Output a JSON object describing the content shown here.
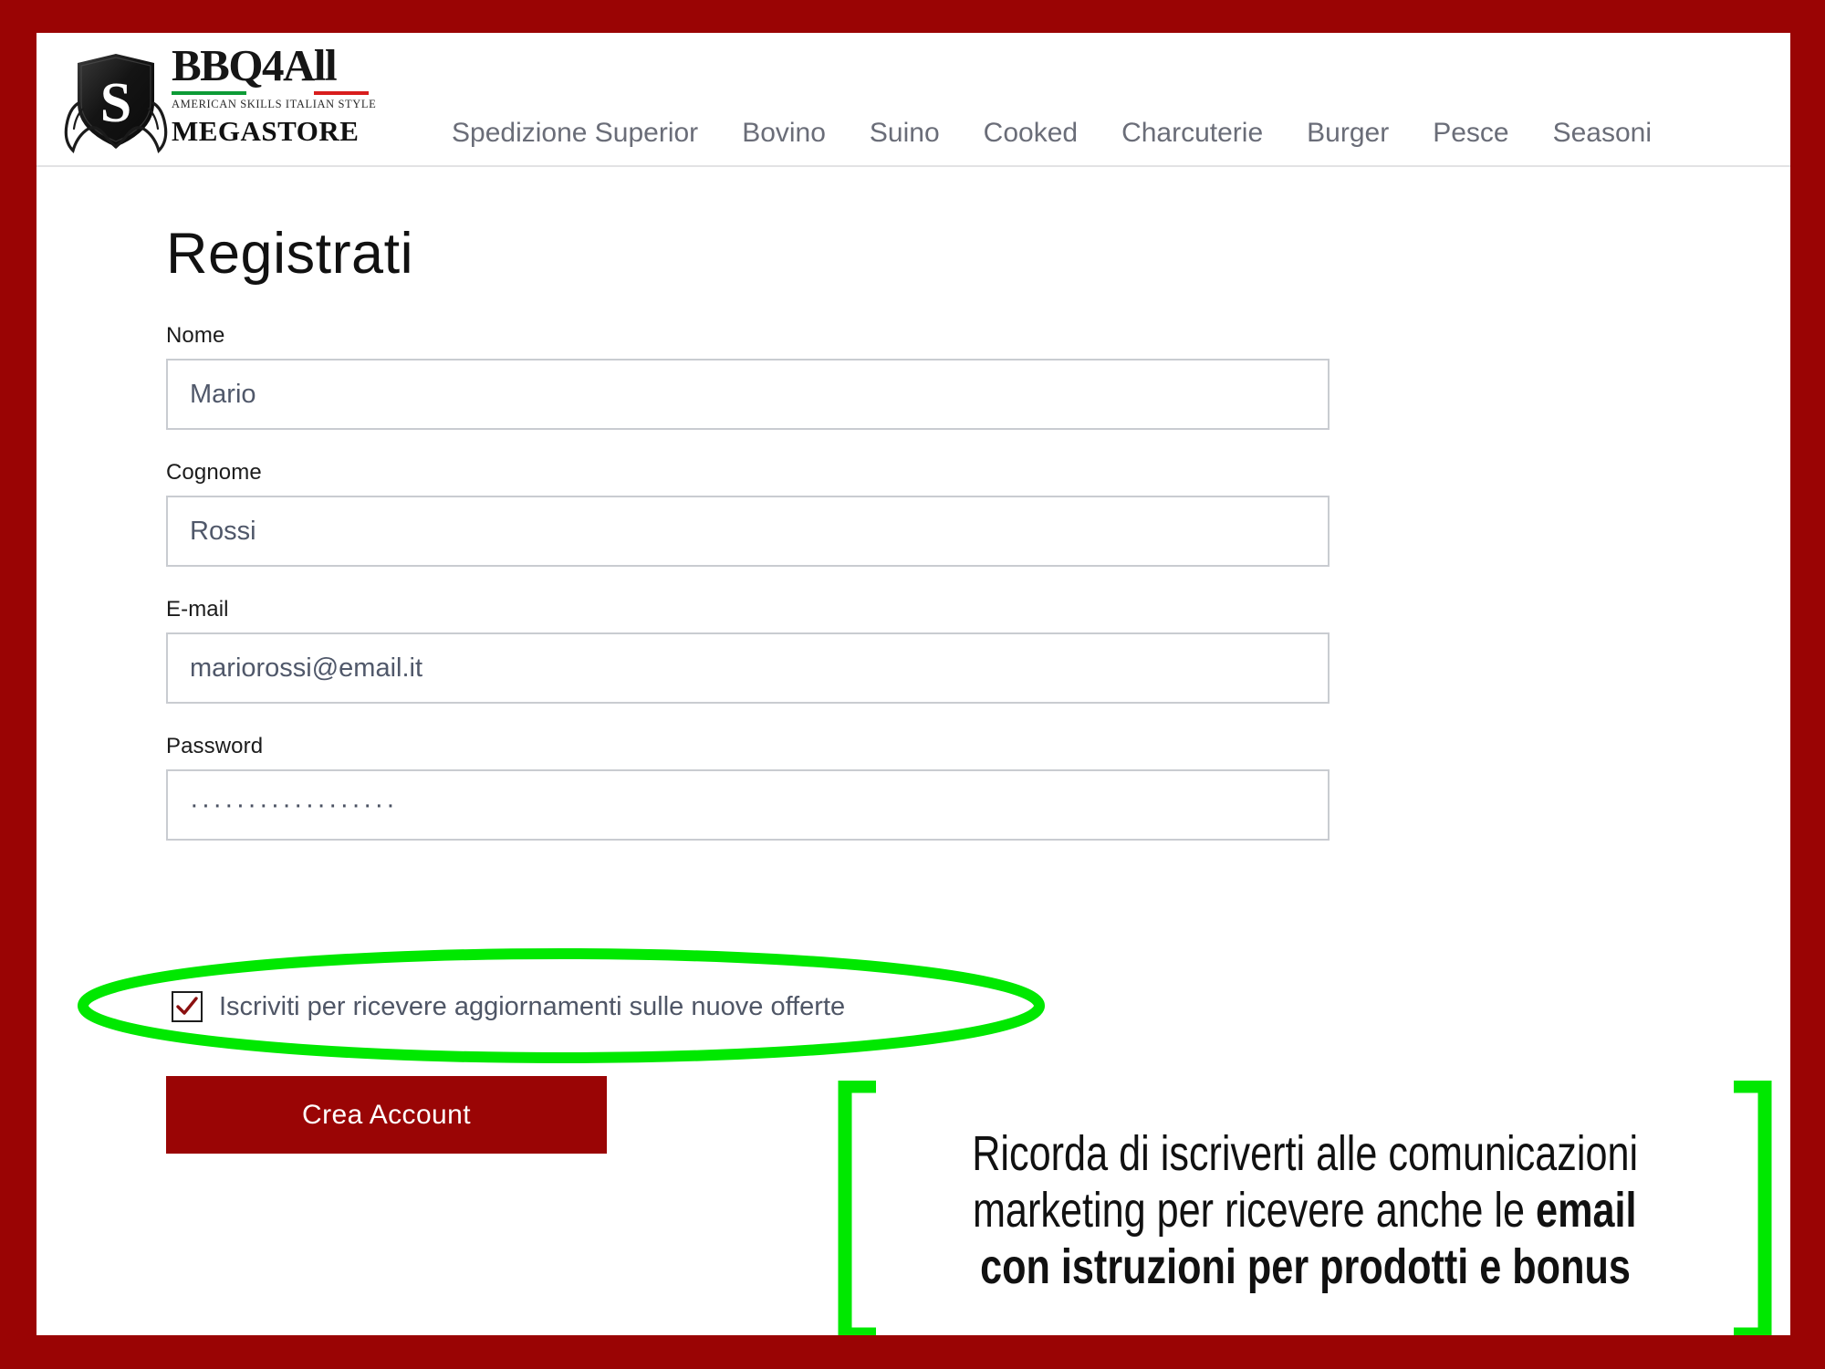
{
  "theme": {
    "frame_color": "#9a0404",
    "page_background": "#ffffff",
    "brand_red": "#9a0505",
    "annotation_green": "#00e800",
    "input_border": "#c9ccd1",
    "nav_text": "#6a6d78",
    "input_text": "#50586a"
  },
  "header": {
    "logo": {
      "shield_letter": "S",
      "wordmark": "BBQ4All",
      "tagline": "AMERICAN SKILLS  ITALIAN STYLE",
      "store_label": "MEGASTORE"
    },
    "nav": [
      {
        "label": "Spedizione Superior"
      },
      {
        "label": "Bovino"
      },
      {
        "label": "Suino"
      },
      {
        "label": "Cooked"
      },
      {
        "label": "Charcuterie"
      },
      {
        "label": "Burger"
      },
      {
        "label": "Pesce"
      },
      {
        "label": "Seasoni"
      }
    ]
  },
  "form": {
    "title": "Registrati",
    "fields": [
      {
        "label": "Nome",
        "value": "Mario",
        "placeholder": "Nome",
        "type": "text"
      },
      {
        "label": "Cognome",
        "value": "Rossi",
        "placeholder": "Cognome",
        "type": "text"
      },
      {
        "label": "E-mail",
        "value": "mariorossi@email.it",
        "placeholder": "E-mail",
        "type": "email"
      },
      {
        "label": "Password",
        "value": "··················",
        "placeholder": "Password",
        "type": "password"
      }
    ],
    "newsletter": {
      "label": "Iscriviti per ricevere aggiornamenti sulle nuove offerte",
      "checked": true,
      "check_color": "#8b1010"
    },
    "submit_label": "Crea Account"
  },
  "annotations": {
    "ellipse_target": "newsletter-checkbox-row",
    "callout": {
      "line1": "Ricorda di iscriverti alle comunicazioni",
      "line2_plain": "marketing per ricevere anche le ",
      "line2_bold": "email",
      "line3": "con istruzioni per prodotti e bonus"
    }
  }
}
